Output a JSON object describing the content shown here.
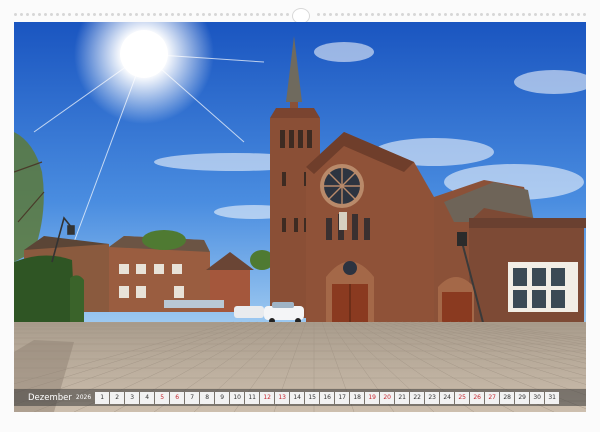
{
  "calendar": {
    "month": "Dezember",
    "year": "2026",
    "days": [
      "1",
      "2",
      "3",
      "4",
      "5",
      "6",
      "7",
      "8",
      "9",
      "10",
      "11",
      "12",
      "13",
      "14",
      "15",
      "16",
      "17",
      "18",
      "19",
      "20",
      "21",
      "22",
      "23",
      "24",
      "25",
      "26",
      "27",
      "28",
      "29",
      "30",
      "31"
    ],
    "weekend_days": [
      "5",
      "6",
      "12",
      "13",
      "19",
      "20",
      "25",
      "26",
      "27"
    ]
  },
  "colors": {
    "sky_top": "#1e5fc8",
    "sky_bottom": "#7fb6ec",
    "brick": "#8a4f36",
    "pavement": "#b8aa98",
    "weekend_text": "#c4262e"
  },
  "photo": {
    "subject": "church-photo"
  }
}
